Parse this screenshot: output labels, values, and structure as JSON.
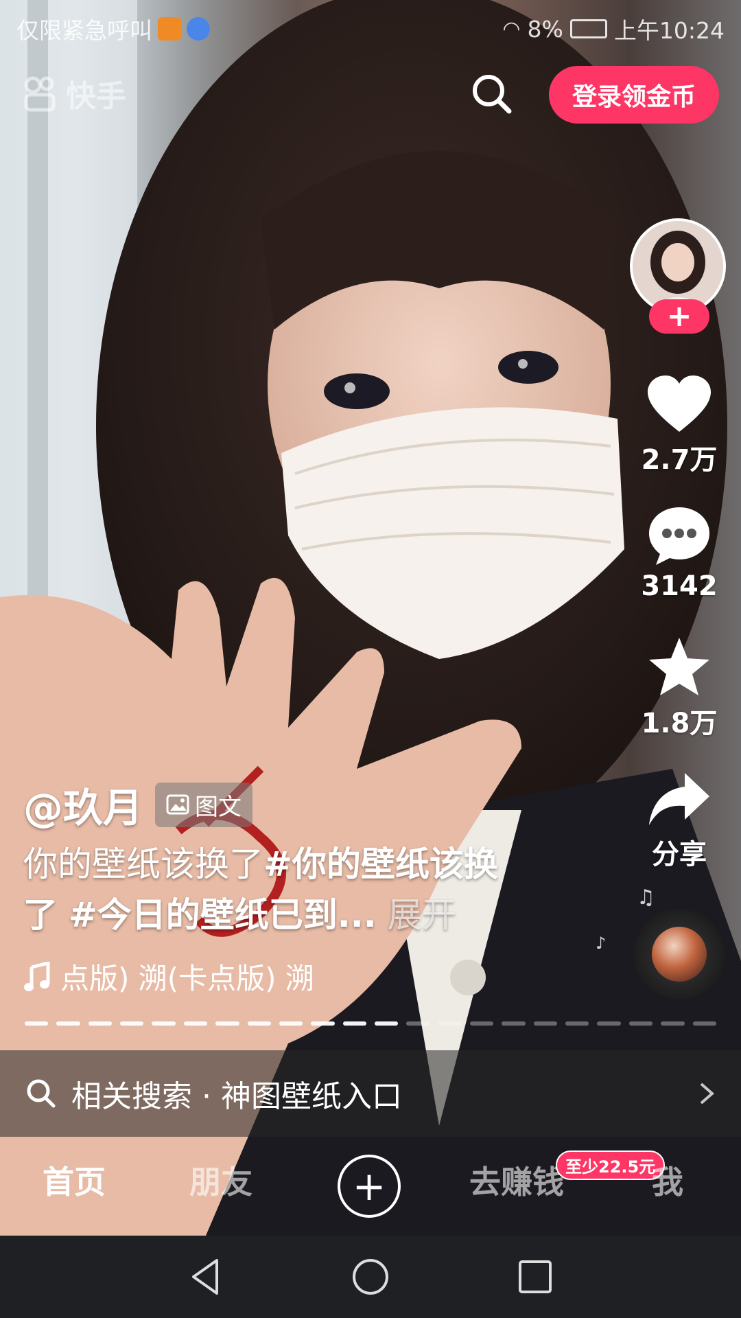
{
  "status_bar": {
    "carrier": "仅限紧急呼叫",
    "battery": "8%",
    "time": "上午10:24"
  },
  "header": {
    "logo_text": "快手",
    "login_label": "登录领金币"
  },
  "right_actions": {
    "like_count": "2.7万",
    "comment_count": "3142",
    "favorite_count": "1.8万",
    "share_label": "分享"
  },
  "post": {
    "author": "@玖月",
    "type_badge": "图文",
    "caption_text": "你的壁纸该换了",
    "caption_tag1": "#你的壁纸该换了",
    "caption_tag2": "#今日的壁纸已到...",
    "expand_label": "展开",
    "music_text": "点版)     溯(卡点版)     溯"
  },
  "progress": {
    "total_segments": 22,
    "active_segments": 12
  },
  "related_search": {
    "label": "相关搜索 · 神图壁纸入口"
  },
  "tabs": {
    "home": "首页",
    "friends": "朋友",
    "plus": "+",
    "earn": "去赚钱",
    "earn_badge": "至少22.5元",
    "me": "我"
  },
  "colors": {
    "accent": "#fe3666",
    "navbar": "#1f2024"
  },
  "icons": [
    "search-icon",
    "heart-icon",
    "comment-icon",
    "star-icon",
    "share-icon",
    "music-note-icon",
    "chevron-right-icon",
    "back-icon",
    "home-circle-icon",
    "recents-icon",
    "image-icon"
  ]
}
